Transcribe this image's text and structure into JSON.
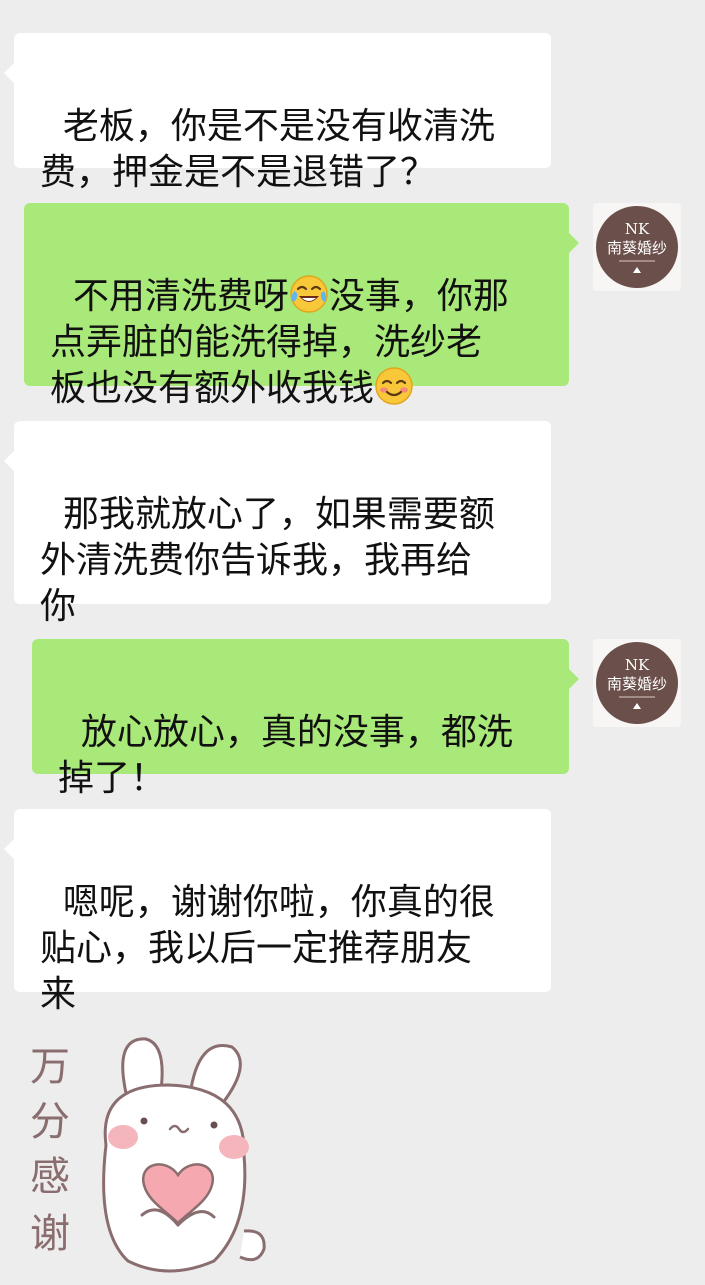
{
  "messages": [
    {
      "side": "left",
      "text": "老板，你是不是没有收清洗\n费，押金是不是退错了？"
    },
    {
      "side": "right",
      "part1": "不用清洗费呀",
      "part2": "没事，你那\n点弄脏的能洗得掉，洗纱老\n板也没有额外收我钱",
      "emoji_after_part1": "tears-of-joy-emoji",
      "emoji_end": "smiling-face-emoji"
    },
    {
      "side": "left",
      "text": "那我就放心了，如果需要额\n外清洗费你告诉我，我再给\n你"
    },
    {
      "side": "right",
      "text": "放心放心，真的没事，都洗\n掉了！"
    },
    {
      "side": "left",
      "text": "嗯呢，谢谢你啦，你真的很\n贴心，我以后一定推荐朋友\n来"
    }
  ],
  "avatar": {
    "logo_letters": "NK",
    "shop_name": "南葵婚纱",
    "logo_color": "#6b4f4a"
  },
  "sticker": {
    "caption_chars": [
      "万",
      "分",
      "感",
      "谢"
    ],
    "icon": "bunny-holding-heart-sticker"
  },
  "colors": {
    "background": "#ededed",
    "incoming_bubble": "#ffffff",
    "outgoing_bubble": "#a9e979"
  }
}
